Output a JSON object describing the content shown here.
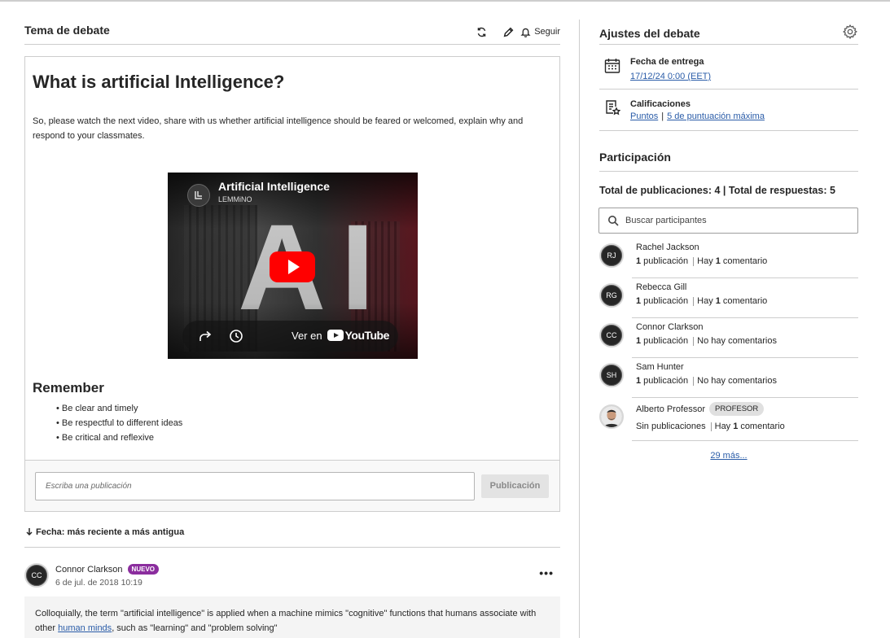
{
  "topic": {
    "header_title": "Tema de debate",
    "follow_label": "Seguir",
    "title": "What is artificial Intelligence?",
    "description": "So, please watch the next video, share with us whether artificial intelligence should be feared or welcomed, explain why and respond to your classmates.",
    "video": {
      "title": "Artificial Intelligence",
      "channel": "LEMMiNO",
      "big_text": "AI",
      "watch_on": "Ver en",
      "platform": "YouTube"
    },
    "remember_title": "Remember",
    "remember_items": [
      "Be clear and timely",
      "Be respectful to different ideas",
      "Be critical and reflexive"
    ]
  },
  "composer": {
    "placeholder": "Escriba una publicación",
    "submit_label": "Publicación"
  },
  "sort": {
    "label": "Fecha: más reciente a más antigua"
  },
  "reply": {
    "initials": "CC",
    "author": "Connor Clarkson",
    "badge": "NUEVO",
    "date": "6 de jul. de 2018 10:19",
    "body_before": "Colloquially, the term \"artificial intelligence\" is applied when a machine mimics \"cognitive\" functions that humans associate with other ",
    "body_link": "human minds",
    "body_after": ", such as \"learning\" and \"problem solving\""
  },
  "settings": {
    "title": "Ajustes del debate",
    "due_label": "Fecha de entrega",
    "due_value": "17/12/24 0:00 (EET)",
    "grades_label": "Calificaciones",
    "grades_type": "Puntos",
    "grades_sep": "|",
    "grades_max": "5 de puntuación máxima"
  },
  "participation": {
    "title": "Participación",
    "totals": "Total de publicaciones: 4 | Total de respuestas: 5",
    "search_placeholder": "Buscar participantes",
    "participants": [
      {
        "initials": "RJ",
        "name": "Rachel Jackson",
        "posts_num": "1",
        "posts_label": "publicación",
        "comments_pre": "Hay",
        "comments_num": "1",
        "comments_label": "comentario"
      },
      {
        "initials": "RG",
        "name": "Rebecca Gill",
        "posts_num": "1",
        "posts_label": "publicación",
        "comments_pre": "Hay",
        "comments_num": "1",
        "comments_label": "comentario"
      },
      {
        "initials": "CC",
        "name": "Connor Clarkson",
        "posts_num": "1",
        "posts_label": "publicación",
        "comments_text": "No hay comentarios"
      },
      {
        "initials": "SH",
        "name": "Sam Hunter",
        "posts_num": "1",
        "posts_label": "publicación",
        "comments_text": "No hay comentarios"
      },
      {
        "name": "Alberto Professor",
        "badge": "PROFESOR",
        "posts_text": "Sin publicaciones",
        "comments_pre": "Hay",
        "comments_num": "1",
        "comments_label": "comentario"
      }
    ],
    "more_link": "29 más..."
  },
  "colors": {
    "link": "#2a5ca8",
    "new_badge": "#8b2d9e",
    "border": "#cdcdcd"
  }
}
